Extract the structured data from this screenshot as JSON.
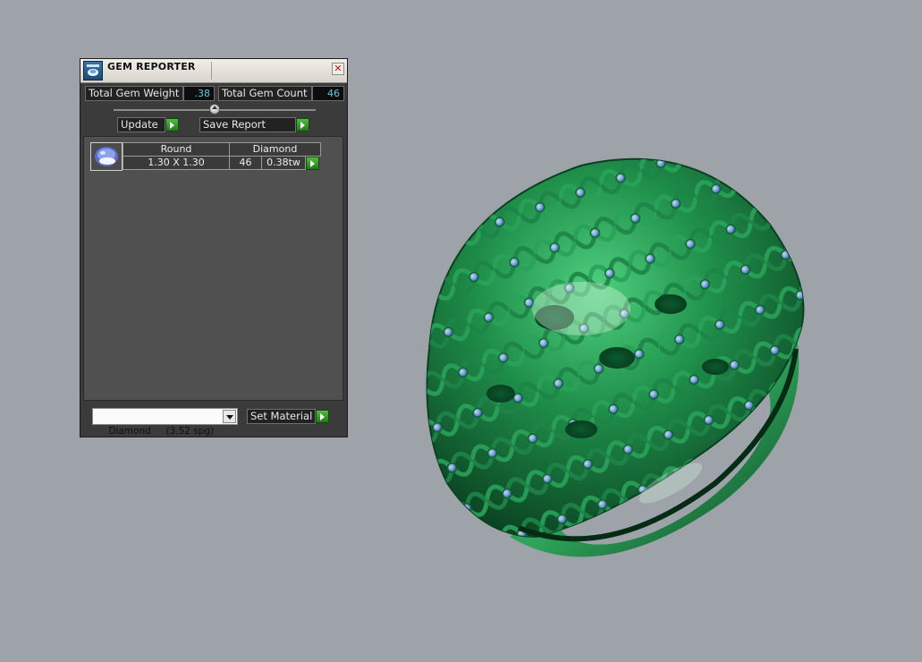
{
  "panel": {
    "title": "GEM REPORTER",
    "close_symbol": "✕",
    "total_gem_weight_label": "Total Gem Weight",
    "total_gem_weight_value": ".38",
    "total_gem_count_label": "Total Gem Count",
    "total_gem_count_value": "46",
    "update_label": "Update",
    "save_report_label": "Save Report",
    "gem_row": {
      "header_cut": "Round",
      "header_type": "Diamond",
      "size": "1.30 X 1.30",
      "count": "46",
      "weight": "0.38tw"
    },
    "material": {
      "selected": "Diamond     (3.52 spg)"
    },
    "set_material_label": "Set Material"
  },
  "icons": [
    "gem-reporter-app-icon",
    "close-icon",
    "slider-knob-icon",
    "arrow-right-icon",
    "round-gem-icon",
    "dropdown-arrow-icon"
  ],
  "colors": {
    "background": "#9da3a8",
    "panel_bg": "#3b3b3b",
    "value_text": "#5fc7e8",
    "arrow_green": "#3a9e2b",
    "ring_green": "#1f8f4a",
    "gem_blue": "#7ea6ea"
  }
}
